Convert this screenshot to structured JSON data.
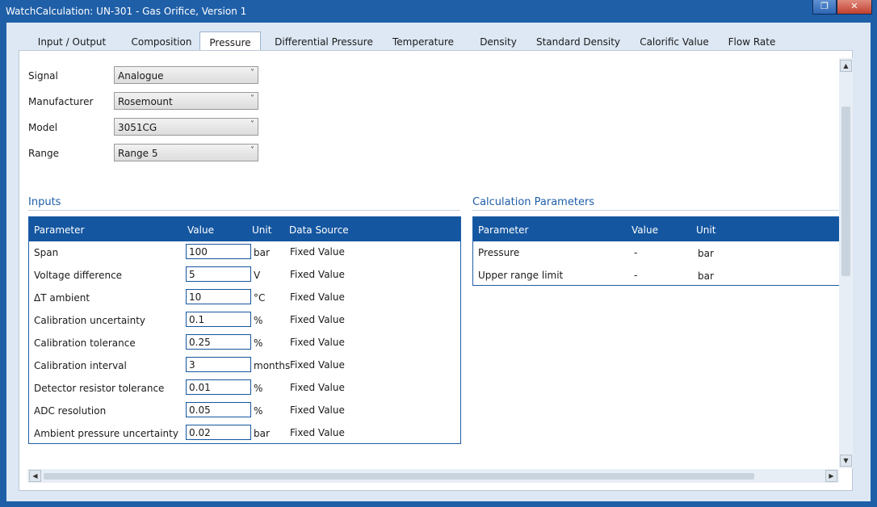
{
  "window": {
    "title": "WatchCalculation: UN-301 - Gas Orifice, Version 1",
    "restore_glyph": "❐",
    "close_glyph": "✕"
  },
  "tabs": [
    "Input / Output",
    "Composition",
    "Pressure",
    "Differential Pressure",
    "Temperature",
    "Density",
    "Standard Density",
    "Calorific Value",
    "Flow Rate"
  ],
  "active_tab": "Pressure",
  "form": {
    "signal": {
      "label": "Signal",
      "value": "Analogue"
    },
    "manufacturer": {
      "label": "Manufacturer",
      "value": "Rosemount"
    },
    "model": {
      "label": "Model",
      "value": "3051CG"
    },
    "range": {
      "label": "Range",
      "value": "Range 5"
    },
    "chevron": "˅"
  },
  "inputs": {
    "title": "Inputs",
    "headers": [
      "Parameter",
      "Value",
      "Unit",
      "Data Source"
    ],
    "rows": [
      {
        "parameter": "Span",
        "value": "100",
        "unit": "bar",
        "source": "Fixed Value"
      },
      {
        "parameter": "Voltage difference",
        "value": "5",
        "unit": "V",
        "source": "Fixed Value"
      },
      {
        "parameter": "ΔT ambient",
        "value": "10",
        "unit": "°C",
        "source": "Fixed Value"
      },
      {
        "parameter": "Calibration uncertainty",
        "value": "0.1",
        "unit": "%",
        "source": "Fixed Value"
      },
      {
        "parameter": "Calibration tolerance",
        "value": "0.25",
        "unit": "%",
        "source": "Fixed Value"
      },
      {
        "parameter": "Calibration interval",
        "value": "3",
        "unit": "months",
        "source": "Fixed Value"
      },
      {
        "parameter": "Detector resistor tolerance",
        "value": "0.01",
        "unit": "%",
        "source": "Fixed Value"
      },
      {
        "parameter": "ADC resolution",
        "value": "0.05",
        "unit": "%",
        "source": "Fixed Value"
      },
      {
        "parameter": "Ambient pressure uncertainty",
        "value": "0.02",
        "unit": "bar",
        "source": "Fixed Value"
      }
    ]
  },
  "calc": {
    "title": "Calculation Parameters",
    "headers": [
      "Parameter",
      "Value",
      "Unit"
    ],
    "rows": [
      {
        "parameter": "Pressure",
        "value": "-",
        "unit": "bar"
      },
      {
        "parameter": "Upper range limit",
        "value": "-",
        "unit": "bar"
      }
    ]
  },
  "scroll": {
    "up": "▲",
    "down": "▼",
    "left": "◀",
    "right": "▶"
  },
  "colors": {
    "frame": "#1f5fa8",
    "grid_header": "#1456a0",
    "section_title": "#1f5fa8"
  }
}
